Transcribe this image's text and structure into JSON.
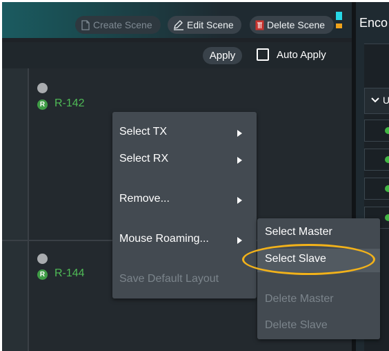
{
  "toolbar": {
    "create_scene": "Create Scene",
    "edit_scene": "Edit Scene",
    "delete_scene": "Delete Scene",
    "apply": "Apply",
    "auto_apply": "Auto Apply"
  },
  "right_panel": {
    "title": "Enco",
    "group_label": "U"
  },
  "receivers": [
    {
      "badge": "R",
      "label": "R-142"
    },
    {
      "badge": "R",
      "label": "R-144"
    }
  ],
  "context_menu": {
    "items": [
      {
        "label": "Select TX"
      },
      {
        "label": "Select RX"
      },
      {
        "label": "Remove..."
      },
      {
        "label": "Mouse Roaming..."
      },
      {
        "label": "Save Default Layout"
      }
    ]
  },
  "submenu": {
    "items": [
      {
        "label": "Select Master"
      },
      {
        "label": "Select Slave"
      },
      {
        "label": "Delete Master"
      },
      {
        "label": "Delete Slave"
      }
    ]
  },
  "colors": {
    "accent_cyan": "#27d7e6",
    "accent_orange": "#f0a21b",
    "status_green": "#4fba56",
    "highlight_ring": "#f2b21a"
  }
}
